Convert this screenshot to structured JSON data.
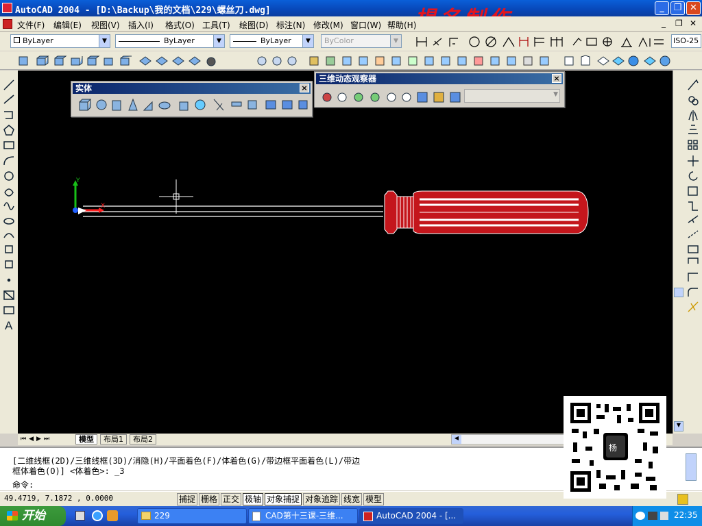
{
  "window": {
    "title": "AutoCAD 2004 - [D:\\Backup\\我的文档\\229\\螺丝刀.dwg]",
    "watermark": "楊名制作"
  },
  "menubar": {
    "items": [
      "文件(F)",
      "编辑(E)",
      "视图(V)",
      "插入(I)",
      "格式(O)",
      "工具(T)",
      "绘图(D)",
      "标注(N)",
      "修改(M)",
      "窗口(W)",
      "帮助(H)"
    ]
  },
  "properties": {
    "layer": "ByLayer",
    "linetype": "ByLayer",
    "lineweight": "ByLayer",
    "color": "ByColor",
    "dimstyle": "ISO-25"
  },
  "panels": {
    "solids": {
      "title": "实体"
    },
    "orbit": {
      "title": "三维动态观察器"
    }
  },
  "tabs": {
    "model": "模型",
    "layout1": "布局1",
    "layout2": "布局2"
  },
  "command": {
    "history_line1": "[二维线框(2D)/三维线框(3D)/消隐(H)/平面着色(F)/体着色(G)/带边框平面着色(L)/带边",
    "history_line2": "框体着色(O)] <体着色>: _3",
    "prompt": "命令:"
  },
  "status": {
    "coords": "49.4719,   7.1872  , 0.0000",
    "buttons": [
      "捕捉",
      "栅格",
      "正交",
      "极轴",
      "对象捕捉",
      "对象追踪",
      "线宽",
      "模型"
    ]
  },
  "taskbar": {
    "start": "开始",
    "tasks": [
      "229",
      "CAD第十三课-三维...",
      "AutoCAD 2004 - [..."
    ],
    "time": "22:35"
  },
  "ucs": {
    "x": "X",
    "y": "Y"
  },
  "colors": {
    "titlebar": "#0a5fd8",
    "watermark": "#e5141c",
    "canvas": "#000000",
    "handle": "#c4161c",
    "axis_x": "#ff2020",
    "axis_y": "#18c018"
  }
}
